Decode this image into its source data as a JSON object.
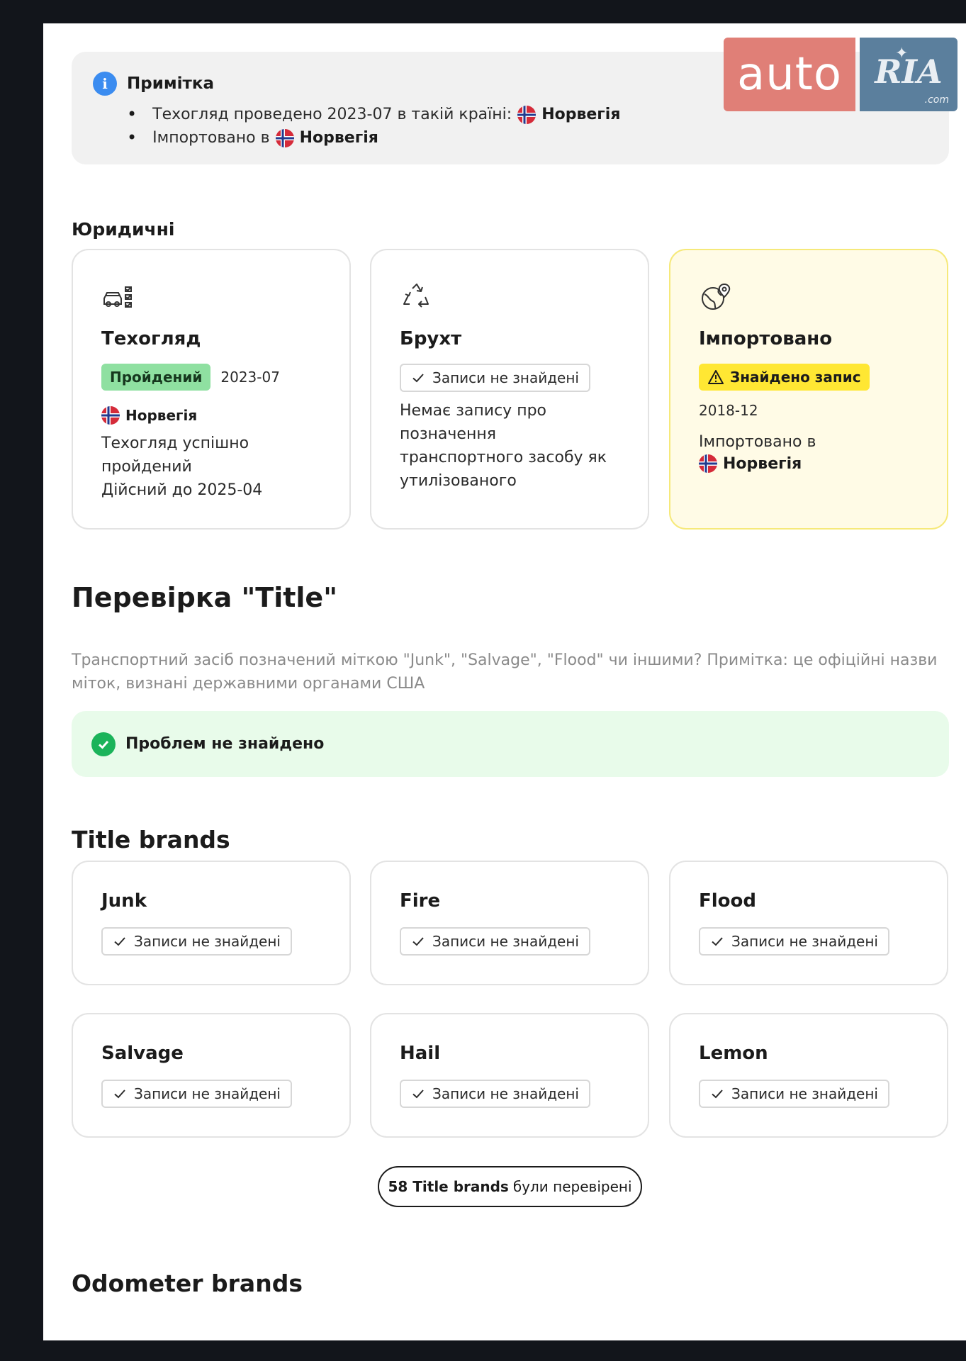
{
  "logo": {
    "auto": "auto",
    "ria": "RIA",
    "com": ".com"
  },
  "note": {
    "title": "Примітка",
    "items": [
      {
        "text": "Техогляд проведено 2023-07 в такій країні:",
        "country": "Норвегія"
      },
      {
        "text": "Імпортовано в",
        "country": "Норвегія"
      }
    ]
  },
  "legal": {
    "heading": "Юридичні",
    "cards": [
      {
        "title": "Техогляд",
        "badge": "Пройдений",
        "date": "2023-07",
        "country": "Норвегія",
        "lines": [
          "Техогляд успішно",
          "пройдений",
          "Дійсний до 2025-04"
        ],
        "icon": "car-checklist-icon"
      },
      {
        "title": "Брухт",
        "chip": "Записи не знайдені",
        "lines": [
          "Немає запису про",
          "позначення",
          "транспортного засобу як",
          "утилізованого"
        ],
        "icon": "recycle-icon"
      },
      {
        "title": "Імпортовано",
        "badge": "Знайдено запис",
        "date": "2018-12",
        "text": "Імпортовано в",
        "country": "Норвегія",
        "icon": "globe-pin-icon"
      }
    ]
  },
  "title_check": {
    "heading": "Перевірка \"Title\"",
    "description": "Транспортний засіб позначений міткою \"Junk\", \"Salvage\", \"Flood\" чи іншими? Примітка: це офіційні назви міток, визнані державними органами США",
    "description_lines": [
      "Транспортний засіб позначений міткою \"Junk\", \"Salvage\", \"Flood\" чи іншими? Примітка: це офіційні назви",
      "міток, визнані державними органами США"
    ],
    "status": "Проблем не знайдено"
  },
  "title_brands": {
    "heading": "Title brands",
    "items": [
      {
        "name": "Junk",
        "status": "Записи не знайдені"
      },
      {
        "name": "Fire",
        "status": "Записи не знайдені"
      },
      {
        "name": "Flood",
        "status": "Записи не знайдені"
      },
      {
        "name": "Salvage",
        "status": "Записи не знайдені"
      },
      {
        "name": "Hail",
        "status": "Записи не знайдені"
      },
      {
        "name": "Lemon",
        "status": "Записи не знайдені"
      }
    ],
    "checked_count": "58 Title brands",
    "checked_suffix": "були перевірені"
  },
  "odometer": {
    "heading": "Odometer brands"
  },
  "colors": {
    "pass": "#8fe0a1",
    "warn": "#ffe733",
    "ok_green": "#1bb35a",
    "info_blue": "#3b8cf0"
  }
}
